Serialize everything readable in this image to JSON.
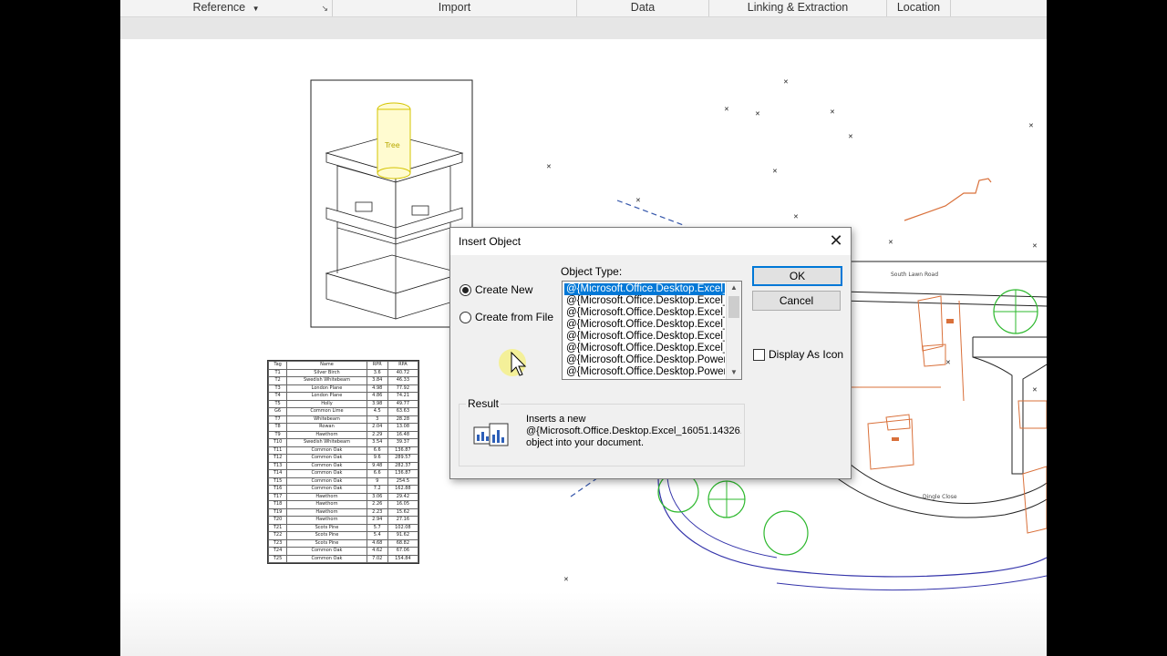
{
  "ribbon": {
    "groups": [
      "Reference",
      "Import",
      "Data",
      "Linking & Extraction",
      "Location"
    ]
  },
  "drawing": {
    "tree_label": "Tree",
    "road_label_1": "South Lawn Road",
    "road_label_2": "Dingle Close"
  },
  "schedule": {
    "headers": [
      "Tag",
      "Name",
      "RPR",
      "RPA"
    ],
    "rows": [
      [
        "T1",
        "Silver Birch",
        "3.6",
        "40.72"
      ],
      [
        "T2",
        "Swedish Whitebeam",
        "3.84",
        "46.33"
      ],
      [
        "T3",
        "London Plane",
        "4.98",
        "77.92"
      ],
      [
        "T4",
        "London Plane",
        "4.86",
        "74.21"
      ],
      [
        "T5",
        "Holly",
        "3.98",
        "49.77"
      ],
      [
        "G6",
        "Common Lime",
        "4.5",
        "63.63"
      ],
      [
        "T7",
        "Whitebeam",
        "3",
        "28.28"
      ],
      [
        "T8",
        "Rowan",
        "2.04",
        "13.08"
      ],
      [
        "T9",
        "Hawthorn",
        "2.29",
        "16.48"
      ],
      [
        "T10",
        "Swedish Whitebeam",
        "3.54",
        "39.37"
      ],
      [
        "T11",
        "Common Oak",
        "6.6",
        "136.87"
      ],
      [
        "T12",
        "Common Oak",
        "9.6",
        "289.57"
      ],
      [
        "T13",
        "Common Oak",
        "9.48",
        "282.37"
      ],
      [
        "T14",
        "Common Oak",
        "6.6",
        "136.87"
      ],
      [
        "T15",
        "Common Oak",
        "9",
        "254.5"
      ],
      [
        "T16",
        "Common Oak",
        "7.2",
        "162.88"
      ],
      [
        "T17",
        "Hawthorn",
        "3.06",
        "29.42"
      ],
      [
        "T18",
        "Hawthorn",
        "2.26",
        "16.05"
      ],
      [
        "T19",
        "Hawthorn",
        "2.23",
        "15.62"
      ],
      [
        "T20",
        "Hawthorn",
        "2.94",
        "27.16"
      ],
      [
        "T21",
        "Scots Pine",
        "5.7",
        "102.08"
      ],
      [
        "T22",
        "Scots Pine",
        "5.4",
        "91.62"
      ],
      [
        "T23",
        "Scots Pine",
        "4.68",
        "68.82"
      ],
      [
        "T24",
        "Common Oak",
        "4.62",
        "67.06"
      ],
      [
        "T25",
        "Common Oak",
        "7.02",
        "154.84"
      ]
    ]
  },
  "dialog": {
    "title": "Insert Object",
    "close_label": "✕",
    "create_new_label": "Create New",
    "create_from_file_label": "Create from File",
    "object_type_label": "Object Type:",
    "object_types": [
      "@{Microsoft.Office.Desktop.Excel_16",
      "@{Microsoft.Office.Desktop.Excel_16",
      "@{Microsoft.Office.Desktop.Excel_16",
      "@{Microsoft.Office.Desktop.Excel_16",
      "@{Microsoft.Office.Desktop.Excel_16",
      "@{Microsoft.Office.Desktop.Excel_16",
      "@{Microsoft.Office.Desktop.PowerPo",
      "@{Microsoft.Office.Desktop.PowerPo"
    ],
    "ok_label": "OK",
    "cancel_label": "Cancel",
    "display_as_icon_label": "Display As Icon",
    "result_label": "Result",
    "result_line1": "Inserts a new",
    "result_line2": "@{Microsoft.Office.Desktop.Excel_16051.14326.",
    "result_line3": "object into your document."
  },
  "icons": {
    "result": "chart-objects-icon",
    "cursor": "mouse-pointer-icon"
  },
  "colors": {
    "accent": "#0078d7",
    "tree_green": "#2db82d",
    "boundary_orange": "#d9703a",
    "road_blue": "#3333aa",
    "highlight_yellow": "#f5f08a"
  }
}
